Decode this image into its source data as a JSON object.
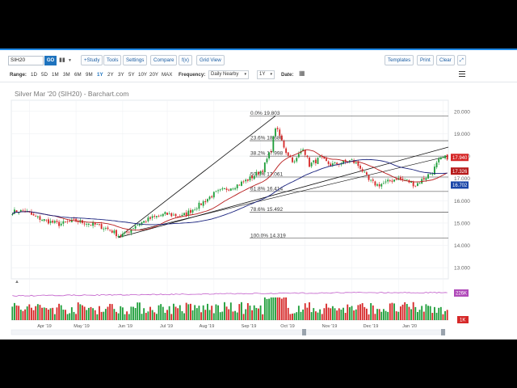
{
  "toolbar": {
    "symbol": "SIH20",
    "go": "GO",
    "study": "+Study",
    "tools": "Tools",
    "settings": "Settings",
    "compare": "Compare",
    "fx": "f(x)",
    "grid_view": "Grid View",
    "templates": "Templates",
    "print": "Print",
    "clear": "Clear"
  },
  "rangebar": {
    "range_label": "Range:",
    "ranges": [
      "1D",
      "5D",
      "1M",
      "3M",
      "6M",
      "9M",
      "1Y",
      "2Y",
      "3Y",
      "5Y",
      "10Y",
      "20Y",
      "MAX"
    ],
    "active_range": "1Y",
    "frequency_label": "Frequency:",
    "frequency_value": "Daily Nearby",
    "period_value": "1Y",
    "date_label": "Date:"
  },
  "chart_data": {
    "type": "candlestick",
    "title": "Silver Mar '20 (SIH20) - Barchart.com",
    "months": [
      "Apr '19",
      "May '19",
      "Jun '19",
      "Jul '19",
      "Aug '19",
      "Sep '19",
      "Oct '19",
      "Nov '19",
      "Dec '19",
      "Jan '20"
    ],
    "ylim": [
      12.5,
      20.5
    ],
    "yticks": [
      "20.000",
      "19.000",
      "18.000",
      "17.000",
      "16.000",
      "15.000",
      "14.000",
      "13.000"
    ],
    "last_price": "17.940",
    "ma_fast_value": "17.326",
    "ma_slow_value": "16.702",
    "fib_levels": [
      {
        "label": "0.0% 19.803",
        "value": 19.803
      },
      {
        "label": "23.6% 18.688",
        "value": 18.688
      },
      {
        "label": "38.2% 17.998",
        "value": 17.998
      },
      {
        "label": "50.0% 17.061",
        "value": 17.061
      },
      {
        "label": "61.8% 16.414",
        "value": 16.414
      },
      {
        "label": "78.6% 15.492",
        "value": 15.492
      },
      {
        "label": "100.0% 14.319",
        "value": 14.319
      }
    ],
    "price_anchors": [
      [
        0,
        15.5
      ],
      [
        6,
        15.55
      ],
      [
        10,
        15.3
      ],
      [
        16,
        15.1
      ],
      [
        22,
        14.95
      ],
      [
        30,
        15.1
      ],
      [
        40,
        14.9
      ],
      [
        46,
        14.7
      ],
      [
        50,
        14.45
      ],
      [
        53,
        14.5
      ],
      [
        58,
        14.9
      ],
      [
        65,
        15.2
      ],
      [
        72,
        15.4
      ],
      [
        80,
        15.3
      ],
      [
        88,
        15.8
      ],
      [
        95,
        16.3
      ],
      [
        100,
        16.5
      ],
      [
        106,
        16.7
      ],
      [
        112,
        17.0
      ],
      [
        118,
        17.4
      ],
      [
        122,
        18.3
      ],
      [
        124,
        19.3
      ],
      [
        126,
        18.9
      ],
      [
        129,
        18.2
      ],
      [
        133,
        17.7
      ],
      [
        137,
        18.4
      ],
      [
        140,
        17.6
      ],
      [
        145,
        17.9
      ],
      [
        150,
        17.6
      ],
      [
        155,
        17.7
      ],
      [
        160,
        17.8
      ],
      [
        164,
        17.5
      ],
      [
        168,
        16.9
      ],
      [
        172,
        16.7
      ],
      [
        176,
        16.8
      ],
      [
        181,
        17.0
      ],
      [
        186,
        16.9
      ],
      [
        190,
        16.7
      ],
      [
        194,
        17.0
      ],
      [
        198,
        17.3
      ],
      [
        201,
        17.8
      ],
      [
        203,
        17.9
      ],
      [
        205,
        17.95
      ]
    ],
    "volume_label": "226K",
    "volume_low_label": "1K"
  }
}
